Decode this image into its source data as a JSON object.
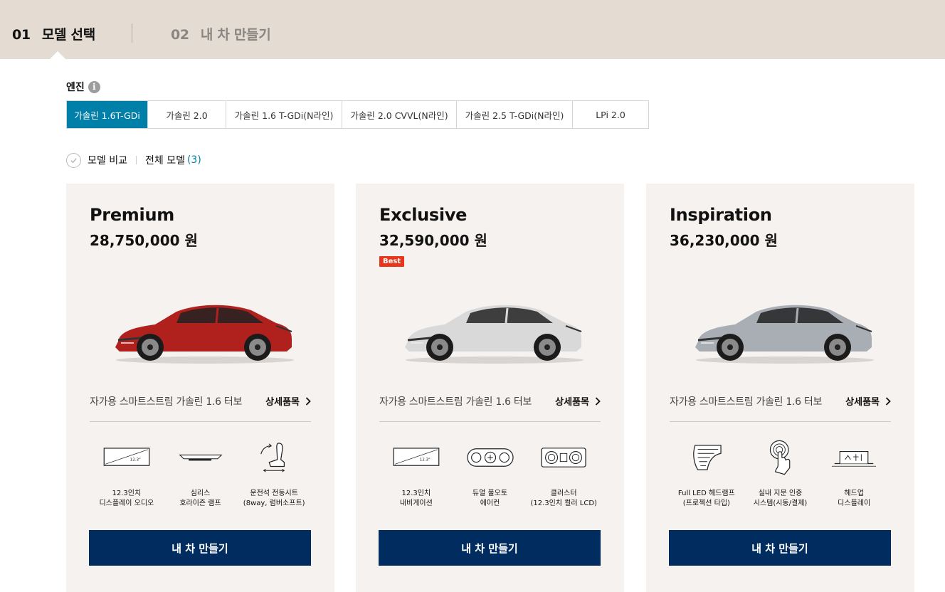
{
  "steps": [
    {
      "num": "01",
      "label": "모델 선택"
    },
    {
      "num": "02",
      "label": "내 차 만들기"
    }
  ],
  "engine": {
    "label": "엔진",
    "info_icon": "i",
    "tabs": [
      {
        "label": "가솔린 1.6T-GDi",
        "active": true
      },
      {
        "label": "가솔린 2.0"
      },
      {
        "label": "가솔린 1.6 T-GDi(N라인)"
      },
      {
        "label": "가솔린 2.0 CVVL(N라인)"
      },
      {
        "label": "가솔린 2.5 T-GDi(N라인)"
      },
      {
        "label": "LPi 2.0"
      }
    ]
  },
  "compare": {
    "label": "모델 비교",
    "all_label": "전체 모델",
    "count": "(3)"
  },
  "cards": [
    {
      "name": "Premium",
      "price": "28,750,000 원",
      "badge": "",
      "car_color": "#b0211e",
      "desc": "자가용 스마트스트림 가솔린 1.6 터보",
      "detail_link": "상세품목",
      "features": [
        {
          "icon": "display-12-3-icon",
          "label": "12.3인치\n디스플레이 오디오"
        },
        {
          "icon": "horizon-lamp-icon",
          "label": "심리스\n호라이즌 램프"
        },
        {
          "icon": "power-seat-icon",
          "label": "운전석 전동시트\n(8way, 럼버소프트)"
        }
      ],
      "build_label": "내 차 만들기"
    },
    {
      "name": "Exclusive",
      "price": "32,590,000 원",
      "badge": "Best",
      "car_color": "#d9d9d9",
      "desc": "자가용 스마트스트림 가솔린 1.6 터보",
      "detail_link": "상세품목",
      "features": [
        {
          "icon": "navigation-12-3-icon",
          "label": "12.3인치\n내비게이션"
        },
        {
          "icon": "dual-auto-aircon-icon",
          "label": "듀얼 풀오토\n에어컨"
        },
        {
          "icon": "cluster-icon",
          "label": "클러스터\n(12.3인치 컬러 LCD)"
        }
      ],
      "build_label": "내 차 만들기"
    },
    {
      "name": "Inspiration",
      "price": "36,230,000 원",
      "badge": "",
      "car_color": "#a9adb4",
      "desc": "자가용 스마트스트림 가솔린 1.6 터보",
      "detail_link": "상세품목",
      "features": [
        {
          "icon": "full-led-headlamp-icon",
          "label": "Full LED 헤드램프\n(프로젝션 타입)"
        },
        {
          "icon": "fingerprint-auth-icon",
          "label": "실내 지문 인증\n시스템(시동/결제)"
        },
        {
          "icon": "head-up-display-icon",
          "label": "헤드업\n디스플레이"
        }
      ],
      "build_label": "내 차 만들기"
    }
  ]
}
